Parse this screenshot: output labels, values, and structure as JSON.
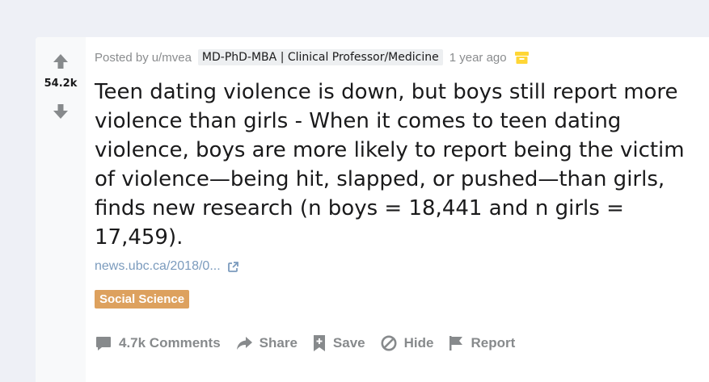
{
  "post": {
    "score": "54.2k",
    "posted_by_prefix": "Posted by",
    "author": "u/mvea",
    "author_flair": "MD-PhD-MBA | Clinical Professor/Medicine",
    "time_ago": "1 year ago",
    "title": "Teen dating violence is down, but boys still report more violence than girls - When it comes to teen dating violence, boys are more likely to report being the victim of violence—being hit, slapped, or pushed—than girls, finds new research (n boys = 18,441 and n girls = 17,459).",
    "link_text": "news.ubc.ca/2018/0...",
    "link_flair": "Social Science"
  },
  "actions": {
    "comments_label": "4.7k Comments",
    "share_label": "Share",
    "save_label": "Save",
    "hide_label": "Hide",
    "report_label": "Report"
  },
  "icons": {
    "upvote": "upvote-arrow-icon",
    "downvote": "downvote-arrow-icon",
    "archive": "archive-box-icon",
    "external_link": "external-link-icon",
    "comments": "comment-bubble-icon",
    "share": "share-arrow-icon",
    "save": "bookmark-plus-icon",
    "hide": "hide-circle-slash-icon",
    "report": "flag-icon"
  },
  "colors": {
    "page_bg": "#eef0f6",
    "vote_column_bg": "#f8f9fa",
    "meta_text": "#8a8c8e",
    "title_text": "#1a1a1b",
    "link_text": "#7b9bbd",
    "link_flair_bg": "#dda15e",
    "archive_icon": "#ffd635",
    "action_text": "#878a8c"
  }
}
